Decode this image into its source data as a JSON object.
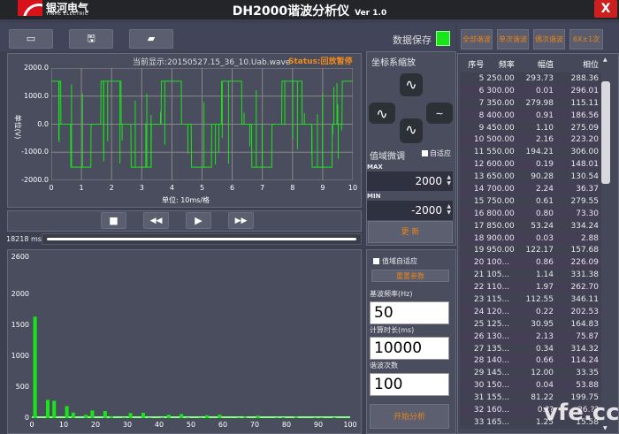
{
  "titlebar": {
    "logo_cn": "银河电气",
    "logo_en": "YINHE ELECTRIC",
    "title": "DH2000谐波分析仪",
    "version": "Ver 1.0",
    "close": "X"
  },
  "toolbar": {
    "btn_icons": [
      "video-icon",
      "save-icon",
      "folder-open-icon"
    ],
    "save_label": "数据保存",
    "led_color": "#19e619"
  },
  "harmonic_filters": [
    "全部谐波",
    "单次谐波",
    "偶次谐波",
    "6X±1次"
  ],
  "waveform": {
    "current_file": "当前显示:20150527.15_36_10.Uab.wave",
    "status": "Status:回放暂停",
    "ylabel": "单位(V)",
    "xlabel": "单位: 10ms/格",
    "yticks": [
      "2000.0",
      "1000.0",
      "0.0",
      "-1000.0",
      "-2000.0"
    ],
    "xticks": [
      "0",
      "1",
      "2",
      "3",
      "4",
      "5",
      "6",
      "7",
      "8",
      "9",
      "10"
    ],
    "trace_color": "#19e619"
  },
  "playback": {
    "buttons": [
      "■",
      "◀◀",
      "▶",
      "▶▶"
    ],
    "time": "18218 ms",
    "progress": 1.0
  },
  "chart_data": {
    "type": "bar",
    "xlim": [
      0,
      100
    ],
    "ylim": [
      0,
      2600
    ],
    "yticks": [
      "0",
      "500",
      "1000",
      "1500",
      "2000",
      "2600"
    ],
    "xticks": [
      "0",
      "10",
      "20",
      "30",
      "40",
      "50",
      "60",
      "70",
      "80",
      "90",
      "100"
    ],
    "x": [
      1,
      5,
      7,
      11,
      13,
      17,
      19,
      23,
      25,
      29,
      31,
      35,
      37,
      41,
      43,
      47,
      49,
      53,
      55,
      59,
      65,
      67,
      71,
      77,
      79,
      83,
      89,
      91,
      95
    ],
    "values": [
      1640,
      294,
      280,
      194,
      90,
      53,
      122,
      113,
      31,
      12,
      81,
      85,
      10,
      12,
      55,
      65,
      10,
      10,
      45,
      55,
      10,
      25,
      40,
      10,
      15,
      25,
      10,
      10,
      15
    ],
    "color": "#19e619"
  },
  "zoom": {
    "title": "坐标系缩放",
    "buttons": [
      "zoom-y-in",
      "zoom-x-in",
      "zoom-x-out",
      "zoom-y-out"
    ]
  },
  "range": {
    "title": "值域微调",
    "auto_label": "自适应",
    "max_label": "MAX",
    "max": "2000",
    "min_label": "MIN",
    "min": "-2000",
    "update": "更  新"
  },
  "params": {
    "auto_range": "值域自适应",
    "reset": "重置参数",
    "freq_label": "基波频率(Hz)",
    "freq": "50",
    "dur_label": "计算时长(ms)",
    "dur": "10000",
    "order_label": "谐波次数",
    "order": "100",
    "start": "开始分析"
  },
  "table": {
    "headers": [
      "序号",
      "频率",
      "幅值",
      "相位"
    ],
    "rows": [
      [
        "5",
        "250.00",
        "293.73",
        "288.36"
      ],
      [
        "6",
        "300.00",
        "0.01",
        "296.01"
      ],
      [
        "7",
        "350.00",
        "279.98",
        "115.11"
      ],
      [
        "8",
        "400.00",
        "0.91",
        "186.56"
      ],
      [
        "9",
        "450.00",
        "1.10",
        "275.09"
      ],
      [
        "10",
        "500.00",
        "2.16",
        "223.20"
      ],
      [
        "11",
        "550.00",
        "194.21",
        "306.00"
      ],
      [
        "12",
        "600.00",
        "0.19",
        "148.01"
      ],
      [
        "13",
        "650.00",
        "90.28",
        "130.54"
      ],
      [
        "14",
        "700.00",
        "2.24",
        "36.37"
      ],
      [
        "15",
        "750.00",
        "0.61",
        "279.55"
      ],
      [
        "16",
        "800.00",
        "0.80",
        "73.30"
      ],
      [
        "17",
        "850.00",
        "53.24",
        "334.24"
      ],
      [
        "18",
        "900.00",
        "0.03",
        "2.88"
      ],
      [
        "19",
        "950.00",
        "122.17",
        "157.68"
      ],
      [
        "20",
        "100...",
        "0.86",
        "226.09"
      ],
      [
        "21",
        "105...",
        "1.14",
        "331.38"
      ],
      [
        "22",
        "110...",
        "1.97",
        "262.70"
      ],
      [
        "23",
        "115...",
        "112.55",
        "346.11"
      ],
      [
        "24",
        "120...",
        "0.22",
        "202.53"
      ],
      [
        "25",
        "125...",
        "30.95",
        "164.83"
      ],
      [
        "26",
        "130...",
        "2.13",
        "75.87"
      ],
      [
        "27",
        "135...",
        "0.34",
        "314.32"
      ],
      [
        "28",
        "140...",
        "0.66",
        "114.24"
      ],
      [
        "29",
        "145...",
        "12.00",
        "33.35"
      ],
      [
        "30",
        "150...",
        "0.04",
        "53.88"
      ],
      [
        "31",
        "155...",
        "81.22",
        "199.75"
      ],
      [
        "32",
        "160...",
        "0.??",
        "26.??"
      ],
      [
        "33",
        "165...",
        "1.25",
        "15.58"
      ]
    ]
  },
  "watermark": "vfe.cc"
}
